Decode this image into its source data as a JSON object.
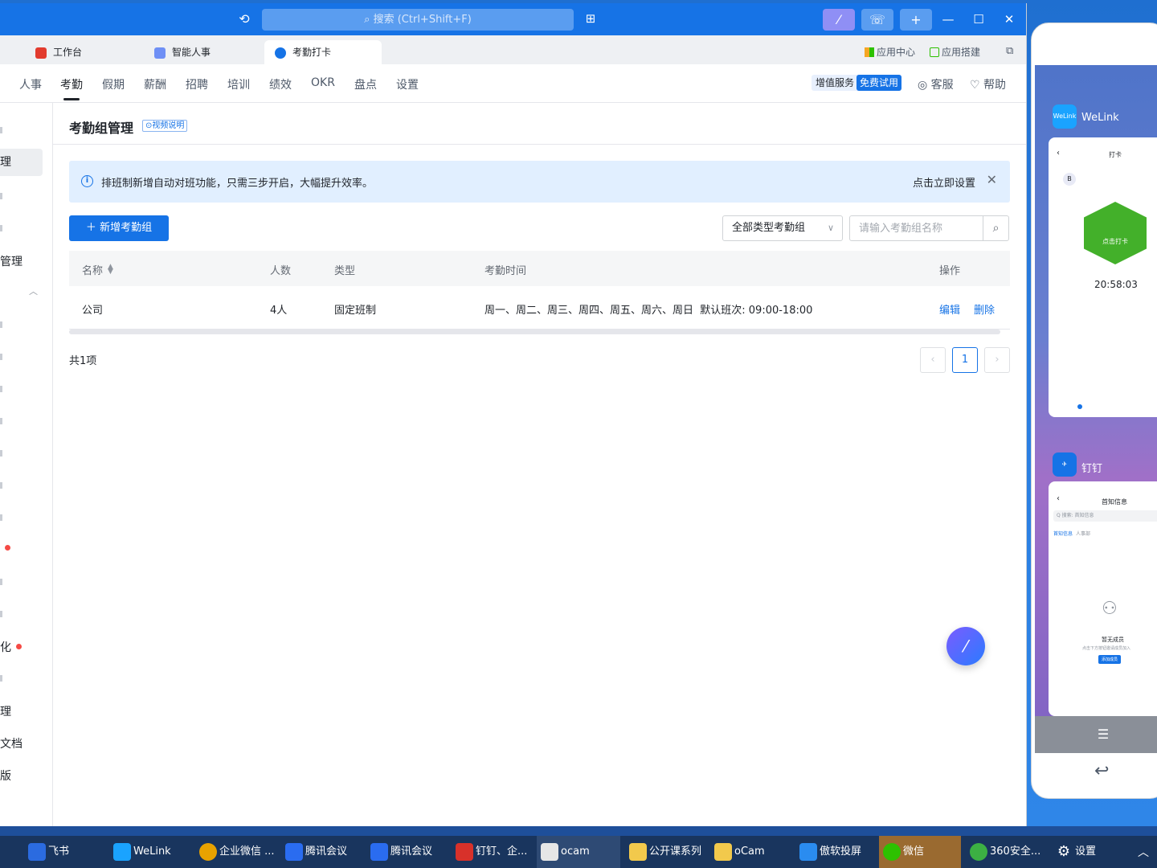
{
  "titlebar": {
    "search_placeholder": "搜索 (Ctrl+Shift+F)",
    "history_icon": "history-icon",
    "grid_icon": "apps-grid-icon",
    "window_controls": [
      "—",
      "☐",
      "✕"
    ]
  },
  "tabs": [
    {
      "label": "工作台",
      "color": "#e23b2e"
    },
    {
      "label": "智能人事",
      "color": "#6e8ff5"
    },
    {
      "label": "考勤打卡",
      "color": "#1673e6"
    }
  ],
  "tab_right": {
    "app_center": "应用中心",
    "app_builder": "应用搭建"
  },
  "nav": {
    "items": [
      "人事",
      "考勤",
      "假期",
      "薪酬",
      "招聘",
      "培训",
      "绩效",
      "OKR",
      "盘点",
      "设置"
    ],
    "active_index": 1,
    "value_added": "增值服务",
    "free_trial": "免费试用",
    "service": "客服",
    "help": "帮助"
  },
  "sidebar": {
    "items": [
      "理",
      "管理",
      "化",
      "理",
      "文档",
      "版"
    ]
  },
  "page": {
    "title": "考勤组管理",
    "video_tag": "⊙视频说明",
    "notice_text": "排班制新增自动对班功能，只需三步开启，大幅提升效率。",
    "notice_action": "点击立即设置",
    "add_button": "新增考勤组",
    "filter_value": "全部类型考勤组",
    "search_placeholder": "请输入考勤组名称"
  },
  "table": {
    "headers": [
      "名称",
      "人数",
      "类型",
      "考勤时间",
      "操作"
    ],
    "rows": [
      {
        "name": "公司",
        "count": "4人",
        "type": "固定班制",
        "time": "周一、周二、周三、周四、周五、周六、周日  默认班次: 09:00-18:00",
        "edit": "编辑",
        "delete": "删除"
      }
    ]
  },
  "pagination": {
    "total": "共1项",
    "current": "1"
  },
  "phone": {
    "welink_label": "WeLink",
    "welink_icon": "WeLink",
    "card1_title": "打卡",
    "punch_label": "点击打卡",
    "time": "20:58:03",
    "dingtalk_label": "钉钉",
    "card2_title": "首知信息",
    "card2_search": "Q 搜索: 首知信息",
    "card2_tab1": "首知信息",
    "card2_tab2": "人事部",
    "empty_text": "暂无成员",
    "empty_sub": "点击下方按钮邀请成员加入",
    "add_btn": "添加成员",
    "nav_icon": "menu-icon"
  },
  "taskbar": [
    {
      "label": "飞书",
      "color": "#2b6be0"
    },
    {
      "label": "WeLink",
      "color": "#1aa3ff"
    },
    {
      "label": "企业微信 ...",
      "color": "#e8a200"
    },
    {
      "label": "腾讯会议",
      "color": "#2a6cf0"
    },
    {
      "label": "腾讯会议",
      "color": "#2a6cf0"
    },
    {
      "label": "钉钉、企...",
      "color": "#d8312a"
    },
    {
      "label": "ocam",
      "color": "#e6e6e6"
    },
    {
      "label": "公开课系列",
      "color": "#f2c94c"
    },
    {
      "label": "oCam",
      "color": "#f2c94c"
    },
    {
      "label": "傲软投屏",
      "color": "#2a8cf0"
    },
    {
      "label": "微信",
      "color": "#2dc100"
    },
    {
      "label": "360安全...",
      "color": "#3cb043"
    },
    {
      "label": "设置",
      "color": "#19355e"
    }
  ]
}
